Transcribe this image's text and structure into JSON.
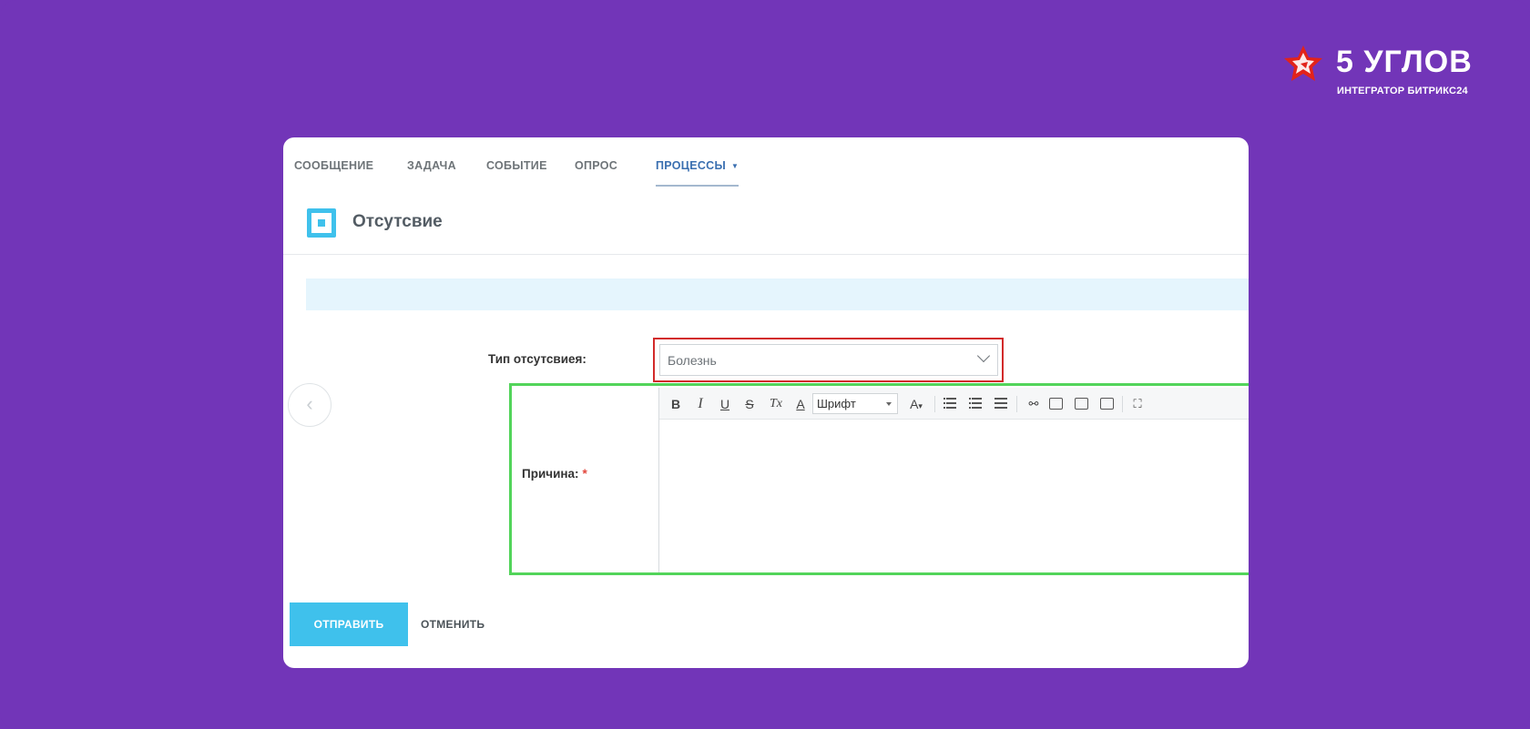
{
  "brand": {
    "name": "5 УГЛОВ",
    "subtitle": "ИНТЕГРАТОР БИТРИКС24",
    "colors": {
      "star": "#e2231a",
      "background": "#7235b8"
    }
  },
  "tabs": [
    {
      "label": "СООБЩЕНИЕ",
      "active": false
    },
    {
      "label": "ЗАДАЧА",
      "active": false
    },
    {
      "label": "СОБЫТИЕ",
      "active": false
    },
    {
      "label": "ОПРОС",
      "active": false
    },
    {
      "label": "ПРОЦЕССЫ",
      "active": true
    }
  ],
  "process": {
    "title": "Отсутсвие",
    "icon": "process-square-icon"
  },
  "form": {
    "absence_type_label": "Тип отсутсвиея:",
    "absence_type_value": "Болезнь",
    "reason_label": "Причина:",
    "required_mark": "*"
  },
  "editor": {
    "toolbar": {
      "bold": "B",
      "italic": "I",
      "underline": "U",
      "strike": "S",
      "clear_format": "Tx",
      "font_color": "A",
      "font_select": "Шрифт",
      "font_size": "A"
    },
    "content": ""
  },
  "actions": {
    "send": "ОТПРАВИТЬ",
    "cancel": "ОТМЕНИТЬ"
  },
  "highlights": {
    "select_border": "#d22a2a",
    "editor_border": "#52d45a"
  }
}
